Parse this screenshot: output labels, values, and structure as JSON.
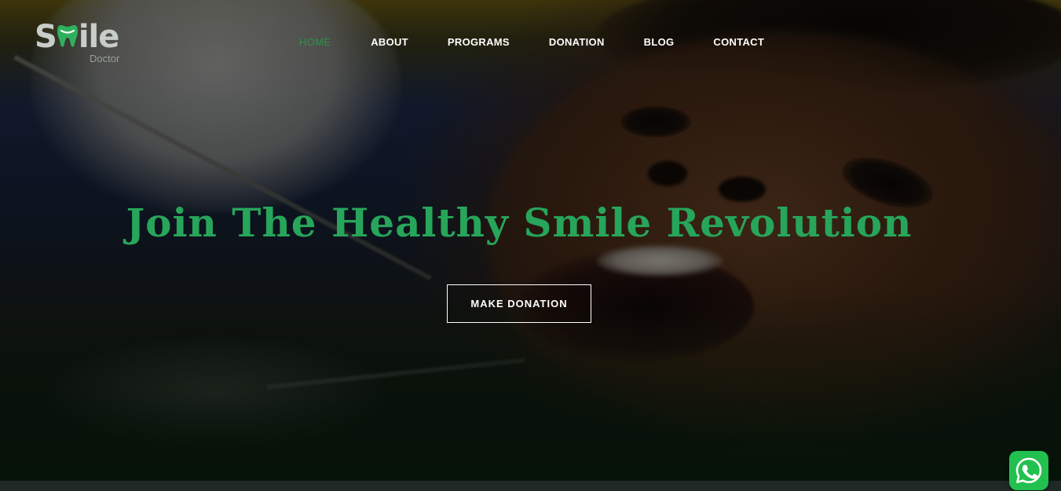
{
  "brand": {
    "logo_word": "Smile",
    "logo_sub": "Doctor",
    "accent_color": "#27a55a"
  },
  "nav": {
    "items": [
      {
        "label": "HOME",
        "active": true
      },
      {
        "label": "ABOUT",
        "active": false
      },
      {
        "label": "PROGRAMS",
        "active": false
      },
      {
        "label": "DONATION",
        "active": false
      },
      {
        "label": "BLOG",
        "active": false
      },
      {
        "label": "CONTACT",
        "active": false
      }
    ]
  },
  "hero": {
    "title": "Join The Healthy Smile Revolution",
    "cta_label": "MAKE DONATION",
    "background": "dentist examining patient teeth photo"
  },
  "floating": {
    "whatsapp_icon": "whatsapp-icon"
  }
}
